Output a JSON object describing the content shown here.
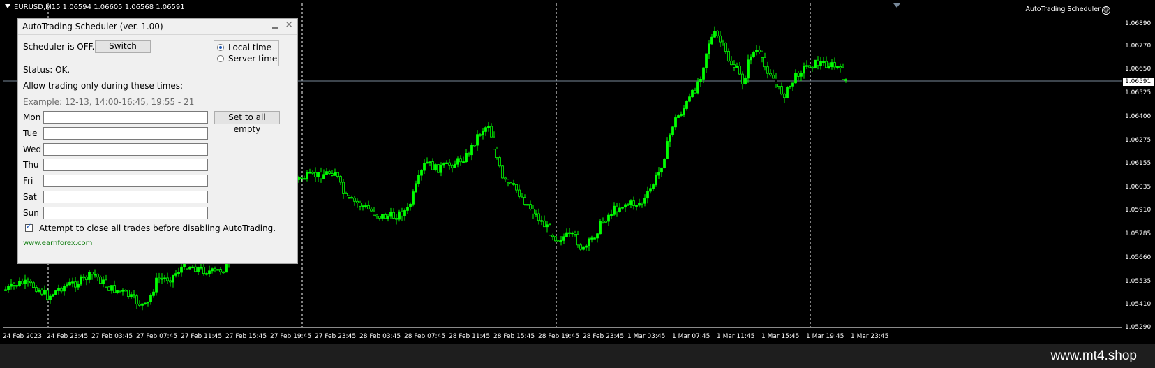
{
  "chart": {
    "symbol_info": "EURUSD,M15  1.06594 1.06605 1.06568 1.06591",
    "ea_label": "AutoTrading Scheduler",
    "current_price": "1.06591",
    "price_ticks": [
      "1.06890",
      "1.06770",
      "1.06650",
      "1.06525",
      "1.06400",
      "1.06275",
      "1.06155",
      "1.06035",
      "1.05910",
      "1.05785",
      "1.05660",
      "1.05535",
      "1.05410",
      "1.05290"
    ],
    "time_ticks": [
      "24 Feb 2023",
      "24 Feb 23:45",
      "27 Feb 03:45",
      "27 Feb 07:45",
      "27 Feb 11:45",
      "27 Feb 15:45",
      "27 Feb 19:45",
      "27 Feb 23:45",
      "28 Feb 03:45",
      "28 Feb 07:45",
      "28 Feb 11:45",
      "28 Feb 15:45",
      "28 Feb 19:45",
      "28 Feb 23:45",
      "1 Mar 03:45",
      "1 Mar 07:45",
      "1 Mar 11:45",
      "1 Mar 15:45",
      "1 Mar 19:45",
      "1 Mar 23:45"
    ],
    "candle_color": "#00ff00",
    "background": "#000000",
    "period_separator_color": "#ffffff",
    "bid_line_color": "#778899"
  },
  "dialog": {
    "title": "AutoTrading Scheduler (ver. 1.00)",
    "scheduler_status": "Scheduler is OFF.",
    "switch_label": "Switch",
    "radio_local": "Local time",
    "radio_server": "Server time",
    "selected_time_mode": "Local time",
    "status": "Status: OK.",
    "allow_text": "Allow trading only during these times:",
    "example": "Example: 12-13, 14:00-16:45, 19:55 - 21",
    "set_empty_label": "Set to all empty",
    "days": [
      {
        "label": "Mon",
        "value": ""
      },
      {
        "label": "Tue",
        "value": ""
      },
      {
        "label": "Wed",
        "value": ""
      },
      {
        "label": "Thu",
        "value": ""
      },
      {
        "label": "Fri",
        "value": ""
      },
      {
        "label": "Sat",
        "value": ""
      },
      {
        "label": "Sun",
        "value": ""
      }
    ],
    "close_trades_checked": true,
    "close_trades_label": "Attempt to close all trades before disabling AutoTrading.",
    "link": "www.earnforex.com"
  },
  "footer": {
    "watermark": "www.mt4.shop"
  }
}
